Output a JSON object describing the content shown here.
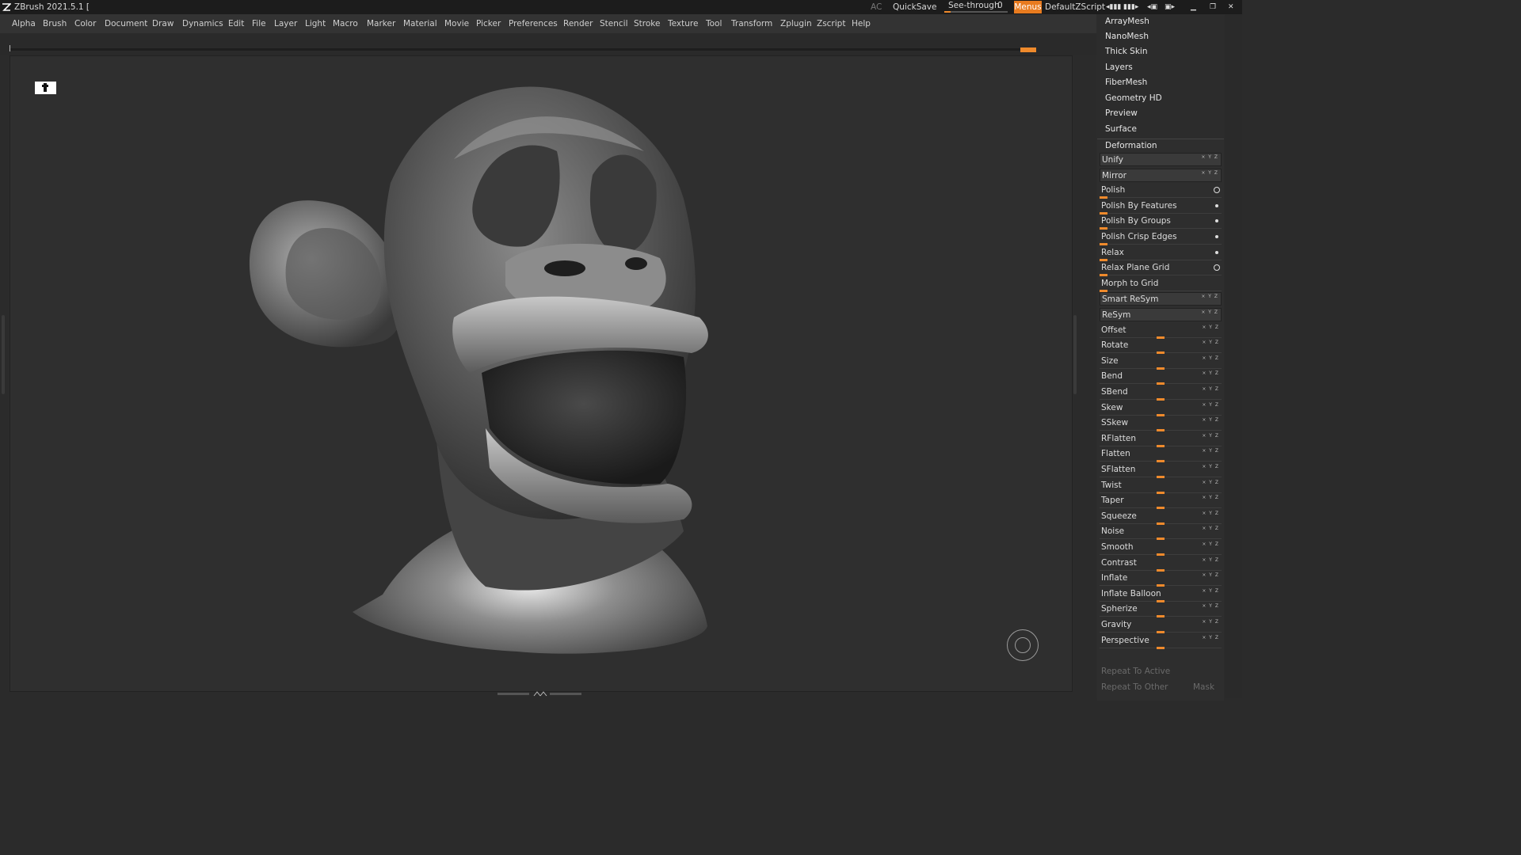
{
  "titlebar": {
    "title": "ZBrush 2021.5.1 [",
    "ac": "AC",
    "quicksave": "QuickSave",
    "see_through_label": "See-through",
    "see_through_value": "0",
    "see_through_level": 0,
    "menus": "Menus",
    "default_zscript": "DefaultZScript"
  },
  "menubar": {
    "items": [
      "Alpha",
      "Brush",
      "Color",
      "Document",
      "Draw",
      "Dynamics",
      "Edit",
      "File",
      "Layer",
      "Light",
      "Macro",
      "Marker",
      "Material",
      "Movie",
      "Picker",
      "Preferences",
      "Render",
      "Stencil",
      "Stroke",
      "Texture",
      "Tool",
      "Transform",
      "Zplugin",
      "Zscript",
      "Help"
    ]
  },
  "tool_subpalettes": [
    "ArrayMesh",
    "NanoMesh",
    "Thick Skin",
    "Layers",
    "FiberMesh",
    "Geometry HD",
    "Preview",
    "Surface"
  ],
  "deformation": {
    "title": "Deformation",
    "rows": [
      {
        "label": "Unify",
        "kind": "button",
        "flags": "x y z"
      },
      {
        "label": "Mirror",
        "kind": "button",
        "flags": "x y z"
      },
      {
        "label": "Polish",
        "kind": "slider-left",
        "indicator": "circle"
      },
      {
        "label": "Polish By Features",
        "kind": "slider-left",
        "indicator": "dot"
      },
      {
        "label": "Polish By Groups",
        "kind": "slider-left",
        "indicator": "dot"
      },
      {
        "label": "Polish Crisp Edges",
        "kind": "slider-left",
        "indicator": "dot"
      },
      {
        "label": "Relax",
        "kind": "slider-left",
        "indicator": "dot"
      },
      {
        "label": "Relax Plane Grid",
        "kind": "slider-left",
        "indicator": "circle"
      },
      {
        "label": "Morph to Grid",
        "kind": "slider-left"
      },
      {
        "label": "Smart ReSym",
        "kind": "button",
        "flags": "x y z"
      },
      {
        "label": "ReSym",
        "kind": "button",
        "flags": "x y z"
      },
      {
        "label": "Offset",
        "kind": "slider-mid",
        "flags": "x y z"
      },
      {
        "label": "Rotate",
        "kind": "slider-mid",
        "flags": "x y z"
      },
      {
        "label": "Size",
        "kind": "slider-mid",
        "flags": "x y z"
      },
      {
        "label": "Bend",
        "kind": "slider-mid",
        "flags": "x y z"
      },
      {
        "label": "SBend",
        "kind": "slider-mid",
        "flags": "x y z"
      },
      {
        "label": "Skew",
        "kind": "slider-mid",
        "flags": "x y z"
      },
      {
        "label": "SSkew",
        "kind": "slider-mid",
        "flags": "x y z"
      },
      {
        "label": "RFlatten",
        "kind": "slider-mid",
        "flags": "x y z"
      },
      {
        "label": "Flatten",
        "kind": "slider-mid",
        "flags": "x y z"
      },
      {
        "label": "SFlatten",
        "kind": "slider-mid",
        "flags": "x y z"
      },
      {
        "label": "Twist",
        "kind": "slider-mid",
        "flags": "x y z"
      },
      {
        "label": "Taper",
        "kind": "slider-mid",
        "flags": "x y z"
      },
      {
        "label": "Squeeze",
        "kind": "slider-mid",
        "flags": "x y z"
      },
      {
        "label": "Noise",
        "kind": "slider-mid",
        "flags": "x y z"
      },
      {
        "label": "Smooth",
        "kind": "slider-mid",
        "flags": "x y z"
      },
      {
        "label": "Contrast",
        "kind": "slider-mid",
        "flags": "x y z"
      },
      {
        "label": "Inflate",
        "kind": "slider-mid",
        "flags": "x y z"
      },
      {
        "label": "Inflate Balloon",
        "kind": "slider-mid",
        "flags": "x y z"
      },
      {
        "label": "Spherize",
        "kind": "slider-mid",
        "flags": "x y z"
      },
      {
        "label": "Gravity",
        "kind": "slider-mid",
        "flags": "x y z"
      },
      {
        "label": "Perspective",
        "kind": "slider-mid",
        "flags": "x y z"
      }
    ],
    "repeat_to_active": "Repeat To Active",
    "repeat_to_other": "Repeat To Other",
    "mask": "Mask"
  },
  "colors": {
    "accent": "#ef8a2c",
    "panel": "#2c2c2c",
    "viewport": "#2f2f2f"
  }
}
